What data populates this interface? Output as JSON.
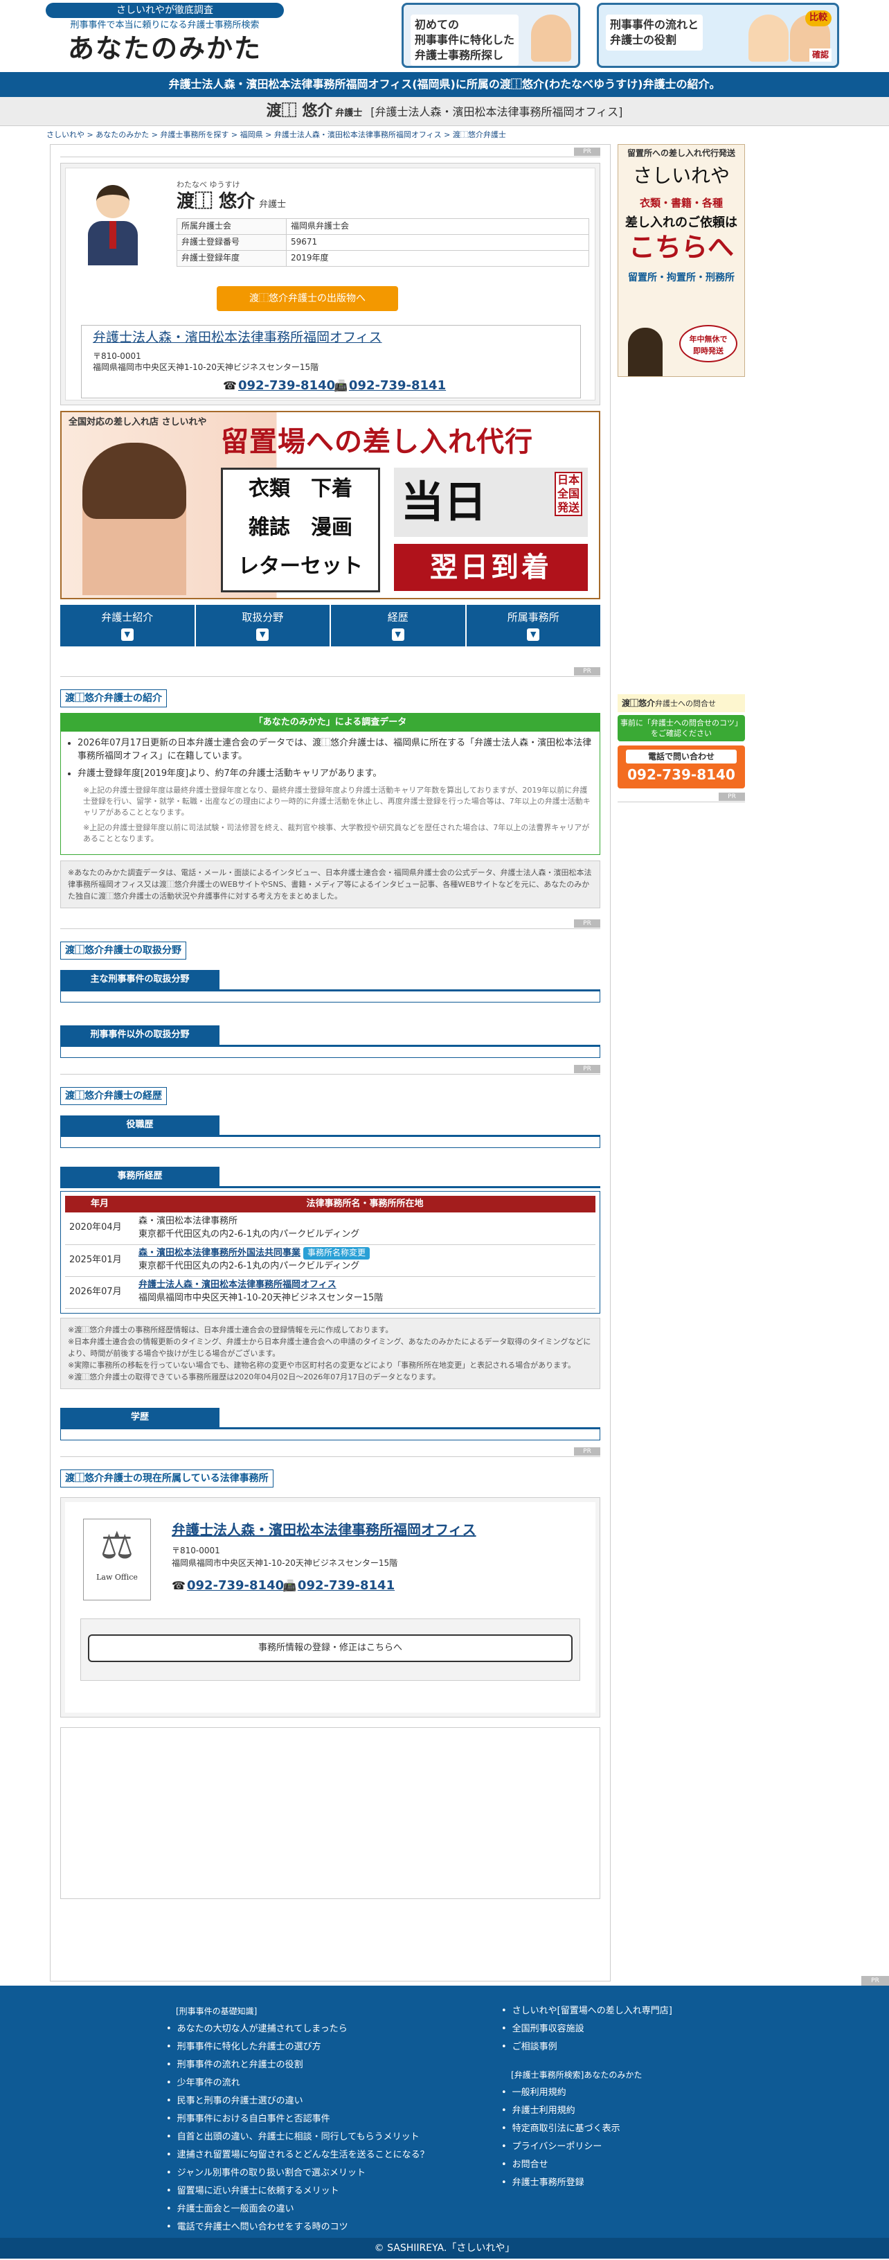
{
  "header": {
    "logo_tagline": "さしいれやが徹底調査",
    "logo_sub": "刑事事件で本当に頼りになる弁護士事務所検索",
    "logo_main": "あなたのみかた",
    "banner1_text": "初めての\n刑事事件に特化した\n弁護士事務所探し",
    "banner2_text": "刑事事件の流れと\n弁護士の役割",
    "banner2_badge": "比較",
    "banner2_badge2": "確認"
  },
  "stripe": "弁護士法人森・濱田松本法律事務所福岡オフィス(福岡県)に所属の渡⿰悠介(わたなべゆうすけ)弁護士の紹介。",
  "title_bar": {
    "name": "渡⿰ 悠介",
    "role": "弁護士",
    "office": "[弁護士法人森・濱田松本法律事務所福岡オフィス]"
  },
  "breadcrumb": "さしいれや > あなたのみかた > 弁護士事務所を探す > 福岡県 > 弁護士法人森・濱田松本法律事務所福岡オフィス > 渡⿰悠介弁護士",
  "pr": "PR",
  "profile": {
    "furigana": "わたなべ ゆうすけ",
    "name": "渡⿰ 悠介",
    "role": "弁護士",
    "rows": [
      {
        "k": "所属弁護士会",
        "v": "福岡県弁護士会"
      },
      {
        "k": "弁護士登録番号",
        "v": "59671"
      },
      {
        "k": "弁護士登録年度",
        "v": "2019年度"
      }
    ],
    "book_button": "渡⿰悠介弁護士の出版物へ",
    "office_name": "弁護士法人森・濱田松本法律事務所福岡オフィス",
    "office_zip": "〒810-0001",
    "office_addr": "福岡県福岡市中央区天神1-10-20天神ビジネスセンター15階",
    "tel": "092-739-8140",
    "fax": "092-739-8141"
  },
  "ad": {
    "top": "全国対応の差し入れ店 さしいれや",
    "title": "留置場への差し入れ代行",
    "items1": "衣類　下着",
    "items2": "雑誌　漫画",
    "items3": "レターセット",
    "sameday": "当日",
    "nationwide": "日本全国発送",
    "nextday": "翌日到着"
  },
  "tabs": [
    "弁護士紹介",
    "取扱分野",
    "経歴",
    "所属事務所"
  ],
  "intro": {
    "heading": "渡⿰悠介弁護士の紹介",
    "green_head": "「あなたのみかた」による調査データ",
    "b1": "2026年07月17日更新の日本弁護士連合会のデータでは、渡⿰悠介弁護士は、福岡県に所在する「弁護士法人森・濱田松本法律事務所福岡オフィス」に在籍しています。",
    "b2": "弁護士登録年度[2019年度]より、約7年の弁護士活動キャリアがあります。",
    "n1": "※上記の弁護士登録年度は最終弁護士登録年度となり、最終弁護士登録年度より弁護士活動キャリア年数を算出しておりますが、2019年以前に弁護士登録を行い、留学・就学・転職・出産などの理由により一時的に弁護士活動を休止し、再度弁護士登録を行った場合等は、7年以上の弁護士活動キャリアがあることとなります。",
    "n2": "※上記の弁護士登録年度以前に司法試験・司法修習を終え、裁判官や検事、大学教授や研究員などを歴任された場合は、7年以上の法曹界キャリアがあることとなります。",
    "gray": "※あなたのみかた調査データは、電話・メール・面談によるインタビュー、日本弁護士連合会・福岡県弁護士会の公式データ、弁護士法人森・濱田松本法律事務所福岡オフィス又は渡⿰悠介弁護士のWEBサイトやSNS、書籍・メディア等によるインタビュー記事、各種WEBサイトなどを元に、あなたのみかた独自に渡⿰悠介弁護士の活動状況や弁護事件に対する考え方をまとめました。"
  },
  "fields": {
    "heading": "渡⿰悠介弁護士の取扱分野",
    "sub1": "主な刑事事件の取扱分野",
    "sub2": "刑事事件以外の取扱分野"
  },
  "career": {
    "heading": "渡⿰悠介弁護士の経歴",
    "sub1": "役職歴",
    "sub2": "事務所経歴",
    "col1": "年月",
    "col2": "法律事務所名・事務所所在地",
    "rows": [
      {
        "y": "2020年04月",
        "name": "森・濱田松本法律事務所",
        "addr": "東京都千代田区丸の内2-6-1丸の内パークビルディング",
        "link": false,
        "badge": ""
      },
      {
        "y": "2025年01月",
        "name": "森・濱田松本法律事務所外国法共同事業",
        "addr": "東京都千代田区丸の内2-6-1丸の内パークビルディング",
        "link": true,
        "badge": "事務所名称変更"
      },
      {
        "y": "2026年07月",
        "name": "弁護士法人森・濱田松本法律事務所福岡オフィス",
        "addr": "福岡県福岡市中央区天神1-10-20天神ビジネスセンター15階",
        "link": true,
        "badge": ""
      }
    ],
    "notes": [
      "※渡⿰悠介弁護士の事務所経歴情報は、日本弁護士連合会の登録情報を元に作成しております。",
      "※日本弁護士連合会の情報更新のタイミング、弁護士から日本弁護士連合会への申請のタイミング、あなたのみかたによるデータ取得のタイミングなどにより、時間が前後する場合や抜けが生じる場合がございます。",
      "※実際に事務所の移転を行っていない場合でも、建物名称の変更や市区町村名の変更などにより「事務所所在地変更」と表記される場合があります。",
      "※渡⿰悠介弁護士の取得できている事務所履歴は2020年04月02日〜2026年07月17日のデータとなります。"
    ],
    "sub3": "学歴"
  },
  "office": {
    "heading": "渡⿰悠介弁護士の現在所属している法律事務所",
    "logo_text": "Law Office",
    "name": "弁護士法人森・濱田松本法律事務所福岡オフィス",
    "zip": "〒810-0001",
    "addr": "福岡県福岡市中央区天神1-10-20天神ビジネスセンター15階",
    "tel": "092-739-8140",
    "fax": "092-739-8141",
    "edit": "事務所情報の登録・修正はこちらへ"
  },
  "side": {
    "b1_t1": "留置所への差し入れ代行発送",
    "b1_t2": "さしいれや",
    "b1_t3": "衣類・書籍・各種",
    "b1_t4": "差し入れのご依頼は",
    "b1_t5": "こちらへ",
    "b1_t6": "留置所・拘置所・刑務所",
    "b1_bubble": "年中無休で\n即時発送",
    "contact_name": "渡⿰悠介",
    "contact_rest": "弁護士への問合せ",
    "green": "事前に「弁護士への問合せのコツ」をご確認ください",
    "orange_a": "電話で問い合わせ",
    "orange_b": "092-739-8140"
  },
  "footer": {
    "col1_head": "[刑事事件の基礎知識]",
    "col1": [
      "あなたの大切な人が逮捕されてしまったら",
      "刑事事件に特化した弁護士の選び方",
      "刑事事件の流れと弁護士の役割",
      "少年事件の流れ",
      "民事と刑事の弁護士選びの違い",
      "刑事事件における自白事件と否認事件",
      "自首と出頭の違い、弁護士に相談・同行してもらうメリット",
      "逮捕され留置場に勾留されるとどんな生活を送ることになる？",
      "ジャンル別事件の取り扱い割合で選ぶメリット",
      "留置場に近い弁護士に依頼するメリット",
      "弁護士面会と一般面会の違い",
      "電話で弁護士へ問い合わせをする時のコツ"
    ],
    "col2a": [
      "さしいれや[留置場への差し入れ専門店]",
      "全国刑事収容施設",
      "ご相談事例"
    ],
    "col2_head": "[弁護士事務所検索]あなたのみかた",
    "col2b": [
      "一般利用規約",
      "弁護士利用規約",
      "特定商取引法に基づく表示",
      "プライバシーポリシー",
      "お問合せ",
      "弁護士事務所登録"
    ],
    "copyright": "© SASHIIREYA.「さしいれや」"
  }
}
